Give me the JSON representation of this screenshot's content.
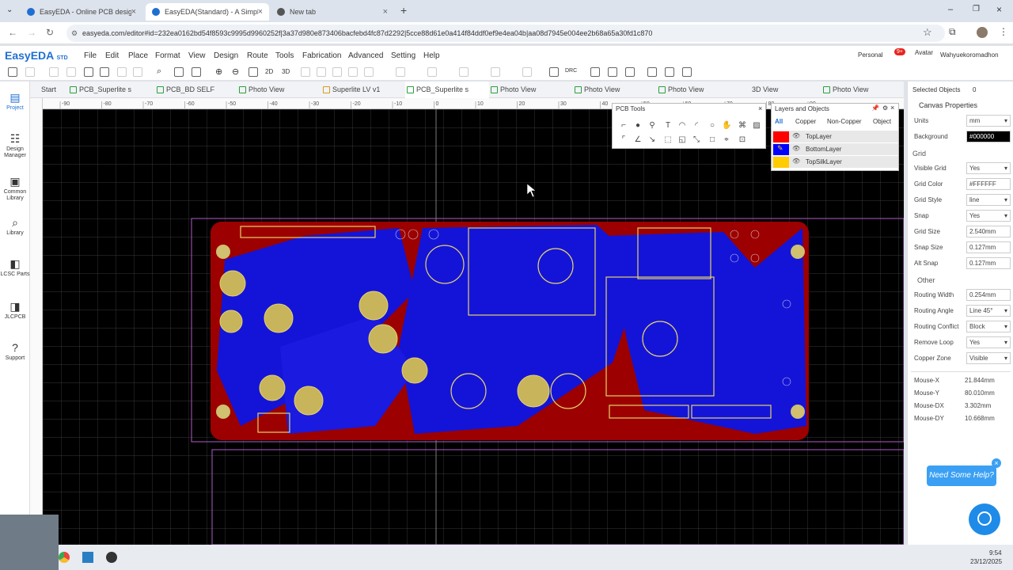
{
  "browser": {
    "tabs": [
      {
        "label": "EasyEDA - Online PCB design &",
        "active": false
      },
      {
        "label": "EasyEDA(Standard) - A Simple a",
        "active": true
      },
      {
        "label": "New tab",
        "active": false
      }
    ],
    "url": "easyeda.com/editor#id=232ea0162bd54f8593c9995d9960252f|3a37d980e873406bacfebd4fc87d2292|5cce88d61e0a414f84ddf0ef9e4ea04b|aa08d7945e004ee2b68a65a30fd1c870"
  },
  "app": {
    "logo": "EasyEDA",
    "logo_sub": "STD",
    "menu": [
      "File",
      "Edit",
      "Place",
      "Format",
      "View",
      "Design",
      "Route",
      "Tools",
      "Fabrication",
      "Advanced",
      "Setting",
      "Help"
    ],
    "account": "Personal",
    "notif_count": "9+",
    "avatar_label": "Avatar",
    "username": "Wahyuekoromadhon",
    "toolbar_2d": "2D",
    "toolbar_3d": "3D",
    "toolbar_drc": "DRC"
  },
  "sidebar": [
    {
      "label": "Project",
      "icon": "project-icon"
    },
    {
      "label": "Design Manager",
      "icon": "design-manager-icon"
    },
    {
      "label": "Common Library",
      "icon": "common-library-icon"
    },
    {
      "label": "Library",
      "icon": "library-icon"
    },
    {
      "label": "LCSC Parts",
      "icon": "lcsc-icon"
    },
    {
      "label": "JLCPCB",
      "icon": "jlcpcb-icon"
    },
    {
      "label": "Support",
      "icon": "support-icon"
    }
  ],
  "doc_tabs": [
    "Start",
    "PCB_Superlite s",
    "PCB_BD SELF",
    "Photo View",
    "Superlite LV v1",
    "PCB_Superlite s",
    "Photo View",
    "Photo View",
    "Photo View",
    "3D View",
    "Photo View"
  ],
  "ruler": {
    "top_labels": [
      "-90",
      "-80",
      "-70",
      "-60",
      "-50",
      "-40",
      "-30",
      "-20",
      "-10",
      "0",
      "10",
      "20",
      "30",
      "40",
      "50",
      "60",
      "70",
      "80",
      "90"
    ]
  },
  "pcb_tools": {
    "title": "PCB Tools"
  },
  "layers": {
    "title": "Layers and Objects",
    "tabs": [
      "All",
      "Copper",
      "Non-Copper",
      "Object"
    ],
    "items": [
      {
        "name": "TopLayer",
        "color": "#ff0000"
      },
      {
        "name": "BottomLayer",
        "color": "#0000ff"
      },
      {
        "name": "TopSilkLayer",
        "color": "#ffcc00"
      }
    ]
  },
  "right_panel": {
    "selected_label": "Selected Objects",
    "selected_count": "0",
    "canvas_title": "Canvas Properties",
    "units_label": "Units",
    "units": "mm",
    "background_label": "Background",
    "background": "#000000",
    "grid_section": "Grid",
    "visible_grid_label": "Visible Grid",
    "visible_grid": "Yes",
    "grid_color_label": "Grid Color",
    "grid_color": "#FFFFFF",
    "grid_style_label": "Grid Style",
    "grid_style": "line",
    "snap_label": "Snap",
    "snap": "Yes",
    "grid_size_label": "Grid Size",
    "grid_size": "2.540mm",
    "snap_size_label": "Snap Size",
    "snap_size": "0.127mm",
    "alt_snap_label": "Alt Snap",
    "alt_snap": "0.127mm",
    "other_section": "Other",
    "routing_width_label": "Routing Width",
    "routing_width": "0.254mm",
    "routing_angle_label": "Routing Angle",
    "routing_angle": "Line 45°",
    "routing_conflict_label": "Routing Conflict",
    "routing_conflict": "Block",
    "remove_loop_label": "Remove Loop",
    "remove_loop": "Yes",
    "copper_zone_label": "Copper Zone",
    "copper_zone": "Visible",
    "mouse_x_label": "Mouse-X",
    "mouse_x": "21.844mm",
    "mouse_y_label": "Mouse-Y",
    "mouse_y": "80.010mm",
    "mouse_dx_label": "Mouse-DX",
    "mouse_dx": "3.302mm",
    "mouse_dy_label": "Mouse-DY",
    "mouse_dy": "10.668mm"
  },
  "help": {
    "label": "Need Some Help?"
  },
  "taskbar": {
    "time": "9:54",
    "date": "23/12/2025"
  }
}
